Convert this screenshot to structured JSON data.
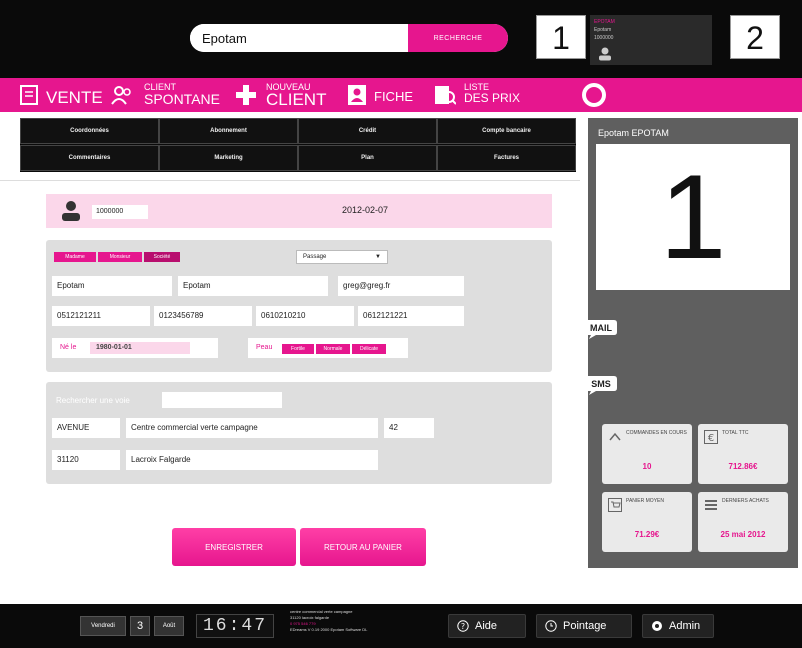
{
  "search": {
    "value": "Epotam",
    "button_label": "RECHERCHE"
  },
  "slots": {
    "left": "1",
    "right": "2"
  },
  "user": {
    "line1": "EPOTAM",
    "line2": "Epotam",
    "line3": "1000000"
  },
  "nav": {
    "vente": "VENTE",
    "client_spontane_small": "CLIENT",
    "client_spontane_big": "SPONTANE",
    "nouveau_client_small": "NOUVEAU",
    "nouveau_client_big": "CLIENT",
    "fiche": "FICHE",
    "liste_prix_small": "LISTE",
    "liste_prix_big": "DES PRIX"
  },
  "subtabs": [
    "Coordonnées",
    "Abonnement",
    "Crédit",
    "Compte bancaire",
    "Commentaires",
    "Marketing",
    "Plan",
    "Factures"
  ],
  "client": {
    "id": "1000000",
    "date": "2012-02-07"
  },
  "identity": {
    "civility_buttons": [
      "Madame",
      "Monsieur",
      "Société"
    ],
    "civility_select": "Passage",
    "last_name": "Epotam",
    "first_name": "Epotam",
    "email": "greg@greg.fr",
    "phones": [
      "0512121211",
      "0123456789",
      "0610210210",
      "0612121221"
    ],
    "birth_label": "Né le",
    "birth_date": "1980-01-01",
    "skin_label": "Peau",
    "skin_buttons": [
      "Fortile",
      "Normale",
      "Délicate"
    ]
  },
  "address": {
    "search_label": "Rechercher une voie",
    "search_value": "",
    "street_type": "AVENUE",
    "street_name": "Centre commercial verte campagne",
    "street_number": "42",
    "postcode": "31120",
    "city": "Lacroix Falgarde"
  },
  "buttons": {
    "save": "ENREGISTRER",
    "back": "RETOUR AU PANIER"
  },
  "right_panel": {
    "title": "Epotam EPOTAM",
    "display": "1",
    "mail_label": "MAIL",
    "sms_label": "SMS",
    "stats": [
      {
        "label": "COMMANDES EN COURS",
        "value": "10",
        "icon": "chevron-up-icon"
      },
      {
        "label": "TOTAL TTC",
        "value": "712.86€",
        "icon": "euro-icon"
      },
      {
        "label": "PANIER MOYEN",
        "value": "71.29€",
        "icon": "cart-icon"
      },
      {
        "label": "DERNIERS ACHATS",
        "value": "25 mai 2012",
        "icon": "list-icon"
      }
    ]
  },
  "bottom": {
    "day_name": "Vendredi",
    "day_num": "3",
    "month": "Août",
    "time": "16:47",
    "store_line1": "centre commercial verte campagne",
    "store_line2": "31120 lacroix falgarde",
    "store_line3": "0 975 546 779",
    "store_line4": "EDreams V 0.19 2000 Epotam Software DL",
    "aide": "Aide",
    "pointage": "Pointage",
    "admin": "Admin"
  },
  "colors": {
    "accent": "#e6168e",
    "dark": "#0a0a0a",
    "panel": "#dedede",
    "right_panel": "#5f5f5f"
  }
}
